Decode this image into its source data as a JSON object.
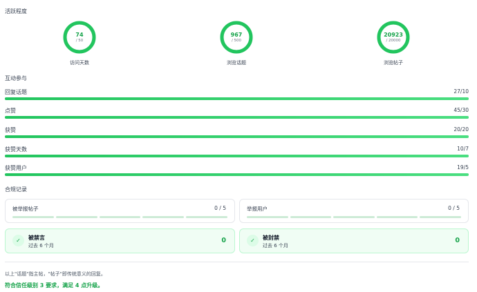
{
  "activity": {
    "title": "活跃程度",
    "rings": [
      {
        "value": "74",
        "goal": "/ 50",
        "label": "访问天数",
        "progress": 1.0
      },
      {
        "value": "967",
        "goal": "/ 500",
        "label": "浏览话题",
        "progress": 1.0
      },
      {
        "value": "20923",
        "goal": "/ 20000",
        "label": "浏览帖子",
        "progress": 1.0
      }
    ]
  },
  "engagement": {
    "title": "互动参与",
    "bars": [
      {
        "label": "回复话题",
        "value": "27/10",
        "progress": 1.0
      },
      {
        "label": "点赞",
        "value": "45/30",
        "progress": 1.0
      },
      {
        "label": "获赞",
        "value": "20/20",
        "progress": 1.0
      },
      {
        "label": "获赞天数",
        "value": "10/7",
        "progress": 1.0
      },
      {
        "label": "获赞用户",
        "value": "19/5",
        "progress": 1.0
      }
    ]
  },
  "compliance": {
    "title": "合规记录",
    "reports": [
      {
        "title": "被举报帖子",
        "count": "0 / 5",
        "filled": 0
      },
      {
        "title": "举报用户",
        "count": "0 / 5",
        "filled": 0
      }
    ],
    "statuses": [
      {
        "title": "被禁言",
        "sub": "过去 6 个月",
        "count": "0",
        "icon": "check-icon"
      },
      {
        "title": "被封禁",
        "sub": "过去 6 个月",
        "count": "0",
        "icon": "check-icon"
      }
    ]
  },
  "footer": {
    "note": "以上\"话题\"指主帖，\"帖子\"即传统意义的回复。",
    "result": "符合信任级别 3 要求，满足 4 点升级。"
  },
  "colors": {
    "accent": "#22c55e",
    "accent_dark": "#16a34a",
    "track": "#e5e7eb"
  }
}
